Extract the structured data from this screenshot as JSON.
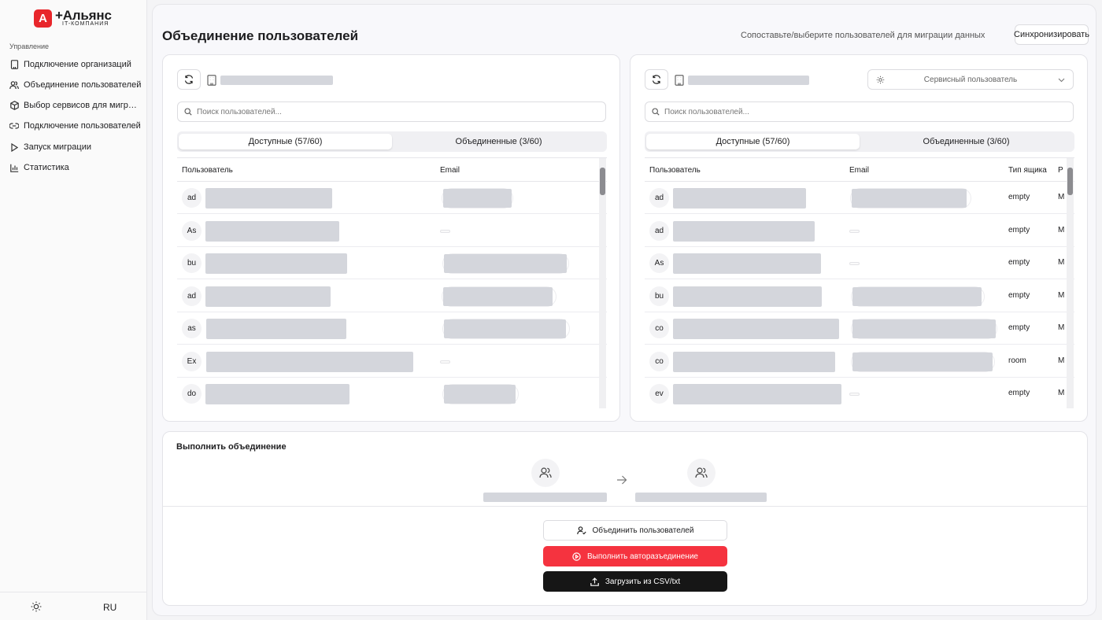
{
  "brand": {
    "mark": "А",
    "name": "+Альянс",
    "subtitle": "IT-КОМПАНИЯ",
    "color": "#e8262b"
  },
  "sidebar": {
    "section": "Управление",
    "items": [
      {
        "label": "Подключение организаций",
        "icon": "building-icon"
      },
      {
        "label": "Объединение пользователей",
        "icon": "users-icon"
      },
      {
        "label": "Выбор сервисов для миграц...",
        "icon": "box-icon"
      },
      {
        "label": "Подключение пользователей",
        "icon": "link-icon"
      },
      {
        "label": "Запуск миграции",
        "icon": "play-icon"
      },
      {
        "label": "Статистика",
        "icon": "bar-chart-icon"
      }
    ],
    "language": "RU"
  },
  "header": {
    "title": "Объединение пользователей",
    "description": "Сопоставьте/выберите пользователей для миграции данных",
    "sync_label": "Синхронизировать"
  },
  "left_panel": {
    "search_placeholder": "Поиск пользователей...",
    "tabs": [
      "Доступные (57/60)",
      "Объединенные (3/60)"
    ],
    "columns": [
      "Пользователь",
      "Email"
    ],
    "rows": [
      {
        "initials": "ad"
      },
      {
        "initials": "As"
      },
      {
        "initials": "bu"
      },
      {
        "initials": "ad"
      },
      {
        "initials": "as"
      },
      {
        "initials": "Ex"
      },
      {
        "initials": "do"
      }
    ]
  },
  "right_panel": {
    "search_placeholder": "Поиск пользователей...",
    "service_user_label": "Сервисный пользователь",
    "tabs": [
      "Доступные (57/60)",
      "Объединенные (3/60)"
    ],
    "columns": [
      "Пользователь",
      "Email",
      "Тип ящика",
      "Р"
    ],
    "rows": [
      {
        "initials": "ad",
        "box_type": "empty",
        "last": "M"
      },
      {
        "initials": "ad",
        "box_type": "empty",
        "last": "M"
      },
      {
        "initials": "As",
        "box_type": "empty",
        "last": "M"
      },
      {
        "initials": "bu",
        "box_type": "empty",
        "last": "M"
      },
      {
        "initials": "co",
        "box_type": "empty",
        "last": "M"
      },
      {
        "initials": "co",
        "box_type": "room",
        "last": "M"
      },
      {
        "initials": "ev",
        "box_type": "empty",
        "last": "M"
      }
    ]
  },
  "merge": {
    "title": "Выполнить объединение",
    "merge_button": "Объединить пользователей",
    "auto_unmerge_button": "Выполнить авторазъединение",
    "upload_button": "Загрузить из CSV/txt",
    "colors": {
      "danger": "#f5333f",
      "dark": "#161616"
    }
  }
}
